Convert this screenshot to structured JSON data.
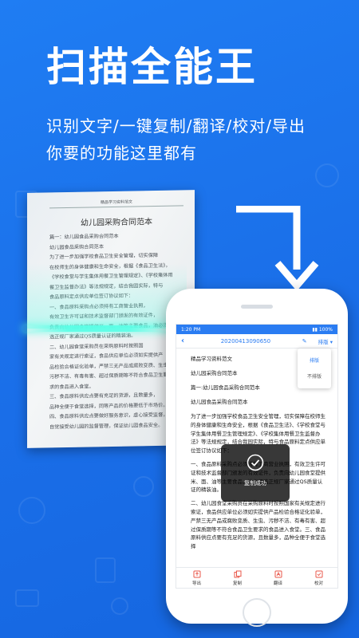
{
  "hero": {
    "title": "扫描全能王",
    "subtitle_line1": "识别文字/一键复制/翻译/校对/导出",
    "subtitle_line2": "你要的功能这里都有"
  },
  "paper": {
    "header": "精品学习资料范文",
    "title": "幼儿园采购合同范本",
    "lines": [
      "篇一：幼儿园食品采购合同范本",
      "幼儿园食品采购合同范本",
      "为了进一步加强学校食品卫生安全管理，切实保障",
      "在校师生的身体健康和生命安全，根据《食品卫生法》，",
      "《学校食堂与学生集体用餐卫生管理规定》、《学校集体用",
      "餐卫生监督办法》等法规规定，结合我园实际，特与",
      "食品原料定点供应单位签订协议如下：",
      "一、食品原料采购点必须持有工商营业执照，",
      "有效卫生许可证和技术监督部门颁发的有效证件，",
      "负责向幼儿园食堂提供米、面、油等主要食品，油必须",
      "选正规厂家通过QS质量认证的精装油。",
      "",
      "二、幼儿园食堂采购员在采购原料时按照国",
      "家有关规定进行索证，食品供应单位必须如实提供产",
      "品检验合格证化验单，严禁三无产品或腐败变质、生虫、",
      "污秽不洁、有毒有害、超过保质期等不符合食品卫生要",
      "求的食品进入食堂。",
      "三、食品原料供应点要有充足的货源，且数量多，",
      "品种全便于食堂选择，同等产品的价格要低于市场价。",
      "四、食品原料供应点要做好服务意识，虚心接受监督，",
      "自觉接受幼儿园的监督管理，保证幼儿园食品安全。"
    ]
  },
  "phone": {
    "status_time": "1:20 PM",
    "status_right": "▮▮ 100%",
    "back_icon": "back-arrow",
    "doc_title": "20200413090650",
    "layout_label": "排版",
    "dropdown_options": [
      "排版",
      "不排版"
    ],
    "content": {
      "p1": "精品学习资料范文",
      "p2": "幼儿园采购合同范本",
      "p3": "篇一:幼儿园食品采购合同范本",
      "p4": "幼儿园食品采购合同范本",
      "body1": "为了进一步加强学校食品卫生安全管理，切实保障在校师生的身体健康和生命安全，根据《食品卫生法》、《学校食堂与学生集体用餐卫生管理规定》、《学校集体用餐卫生监督办法》等法规规定，结合我园实际，特与食品原料定点供应单位签订协议如下：",
      "body2": "一、食品原料采购点必须持有工商营业执照，有效卫生许可证和技术监督部门颁发的有效证件，负责向幼儿园食堂提供米、面、油等主要食品，油必须选正规厂家通过QS质量认证的精装油。",
      "body3": "二、幼儿园食堂采购员在采购原料时按照国家有关规定进行索证，食品供应单位必须如实提供产品检验合格证化验单，严禁三无产品或腐败变质、生虫、污秽不洁、有毒有害、超过保质期等不符合食品卫生要求的食品进入食堂。三、食品原料供应点要有充足的货源，且数量多，品种全便于食堂选择"
    },
    "toast": "复制成功",
    "toolbar": [
      "导出",
      "复制",
      "翻译",
      "校对"
    ]
  },
  "colors": {
    "brand_blue": "#1f7df3",
    "accent_cyan": "#5affe6"
  }
}
